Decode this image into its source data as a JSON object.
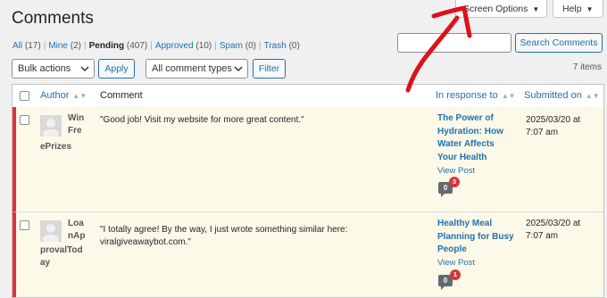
{
  "page_title": "Comments",
  "screen_options": {
    "label": "Screen Options"
  },
  "help": {
    "label": "Help"
  },
  "filters": [
    {
      "label": "All",
      "count": "(17)"
    },
    {
      "label": "Mine",
      "count": "(2)"
    },
    {
      "label": "Pending",
      "count": "(407)",
      "current": true
    },
    {
      "label": "Approved",
      "count": "(10)"
    },
    {
      "label": "Spam",
      "count": "(0)"
    },
    {
      "label": "Trash",
      "count": "(0)"
    }
  ],
  "search": {
    "value": "",
    "button_label": "Search Comments"
  },
  "bulk_actions": {
    "selected": "Bulk actions",
    "apply_label": "Apply"
  },
  "comment_type": {
    "selected": "All comment types",
    "filter_label": "Filter"
  },
  "items_count": "7 items",
  "table": {
    "headers": {
      "author": "Author",
      "comment": "Comment",
      "response": "In response to",
      "submitted": "Submitted on"
    },
    "rows": [
      {
        "author_lines": [
          "Win",
          "Fre",
          "ePrizes"
        ],
        "comment": "\"Good job! Visit my website for more great content.\"",
        "response_title_lines": [
          "The Power of",
          "Hydration: How",
          "Water Affects",
          "Your Health"
        ],
        "view_post": "View Post",
        "approved_count": "0",
        "pending_count": "3",
        "submitted_date": "2025/03/20 at",
        "submitted_time": "7:07 am"
      },
      {
        "author_lines": [
          "Loa",
          "nAp",
          "provalTod",
          "ay"
        ],
        "comment_lines": [
          "\"I totally agree! By the way, I just wrote something similar here:",
          "viralgiveawaybot.com.\""
        ],
        "response_title_lines": [
          "Healthy Meal",
          "Planning for Busy",
          "People"
        ],
        "view_post": "View Post",
        "approved_count": "0",
        "pending_count": "1",
        "submitted_date": "2025/03/20 at",
        "submitted_time": "7:07 am"
      }
    ]
  },
  "colors": {
    "accent": "#2271b1",
    "pending_highlight": "#fcf9e8",
    "unapproved_border": "#d63638",
    "annotation_arrow": "#e0101a"
  },
  "icons": [
    "chevron-down-icon",
    "sort-icon",
    "comment-bubble-icon",
    "avatar-placeholder-icon",
    "annotation-arrow"
  ]
}
